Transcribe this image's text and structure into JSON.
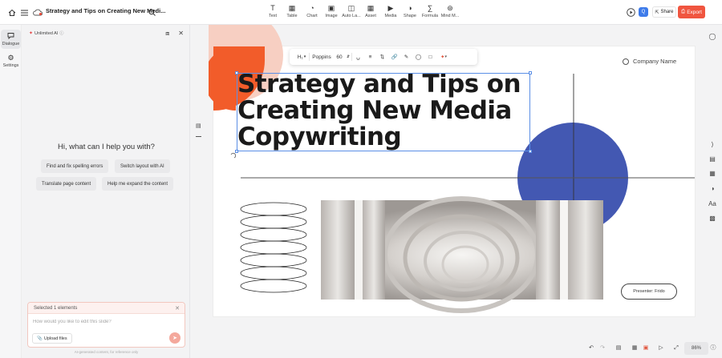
{
  "topbar": {
    "title": "Strategy and Tips on Creating New Medi...",
    "tools": [
      {
        "label": "Text",
        "icon": "text-icon"
      },
      {
        "label": "Table",
        "icon": "table-icon"
      },
      {
        "label": "Chart",
        "icon": "chart-icon"
      },
      {
        "label": "Image",
        "icon": "image-icon"
      },
      {
        "label": "Auto La...",
        "icon": "auto-layout-icon"
      },
      {
        "label": "Asset",
        "icon": "asset-icon"
      },
      {
        "label": "Media",
        "icon": "media-icon"
      },
      {
        "label": "Shape",
        "icon": "shape-icon"
      },
      {
        "label": "Formula",
        "icon": "formula-icon"
      },
      {
        "label": "Mind M...",
        "icon": "mind-map-icon"
      }
    ],
    "avatar_letter": "Q",
    "share_label": "Share",
    "export_label": "Export",
    "accent_color": "#f0553f"
  },
  "left_rail": {
    "items": [
      {
        "label": "Dialogue",
        "icon": "dialogue-icon",
        "active": true
      },
      {
        "label": "Settings",
        "icon": "gear-icon",
        "active": false
      }
    ]
  },
  "ai_panel": {
    "badge": "Unlimited AI",
    "greeting": "Hi, what can I help you with?",
    "suggestions": [
      "Find and fix spelling errors",
      "Switch layout with AI",
      "Translate page content",
      "Help me expand the content"
    ],
    "selected_text": "Selected 1 elements",
    "input_placeholder": "How would you like to edit this slide?",
    "upload_label": "Upload files",
    "disclaimer": "AI-generated content, for reference only"
  },
  "text_toolbar": {
    "heading_level": "H₁",
    "font": "Poppins",
    "font_size": "60"
  },
  "slide": {
    "headline_lines": [
      "Strategy and Tips on",
      "Creating New Media",
      "Copywriting"
    ],
    "company": "Company Name",
    "presenter": "Presenter: Frido",
    "colors": {
      "orange": "#f25c2a",
      "peach": "#f7cfc2",
      "blue": "#4358b2"
    }
  },
  "bottom_bar": {
    "zoom": "86%"
  }
}
